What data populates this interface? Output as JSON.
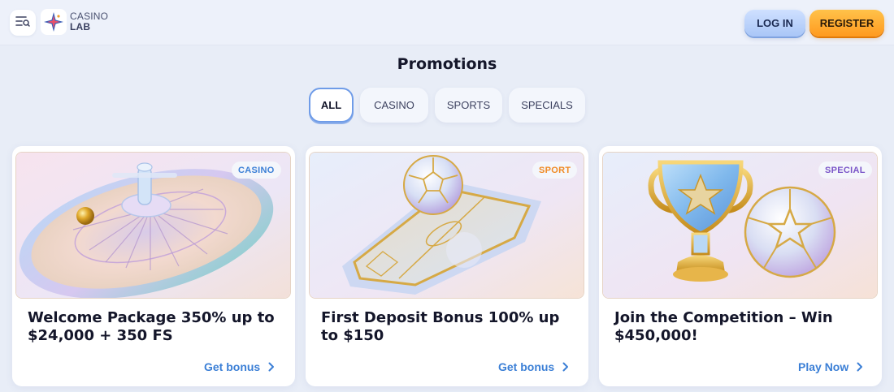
{
  "header": {
    "logo_line1": "CASINO",
    "logo_line2": "LAB",
    "login_label": "LOG IN",
    "register_label": "REGISTER",
    "menu_icon": "menu-search-icon"
  },
  "page": {
    "title": "Promotions"
  },
  "tabs": [
    {
      "label": "ALL",
      "active": true
    },
    {
      "label": "CASINO",
      "active": false
    },
    {
      "label": "SPORTS",
      "active": false
    },
    {
      "label": "SPECIALS",
      "active": false
    }
  ],
  "cards": [
    {
      "badge": "CASINO",
      "badge_color": "#3b7fd6",
      "title": "Welcome Package 350% up to $24,000 + 350 FS",
      "link": "Get bonus",
      "image_icon": "roulette-wheel-icon"
    },
    {
      "badge": "SPORT",
      "badge_color": "#f08a24",
      "title": "First Deposit Bonus 100% up to $150",
      "link": "Get bonus",
      "image_icon": "soccer-field-icon"
    },
    {
      "badge": "SPECIAL",
      "badge_color": "#7a55c8",
      "title": "Join the Competition – Win $450,000!",
      "link": "Play Now",
      "image_icon": "trophy-icon"
    }
  ],
  "colors": {
    "accent": "#3b7fd6",
    "register": "#ff9a1f",
    "background": "#e8edf7"
  }
}
